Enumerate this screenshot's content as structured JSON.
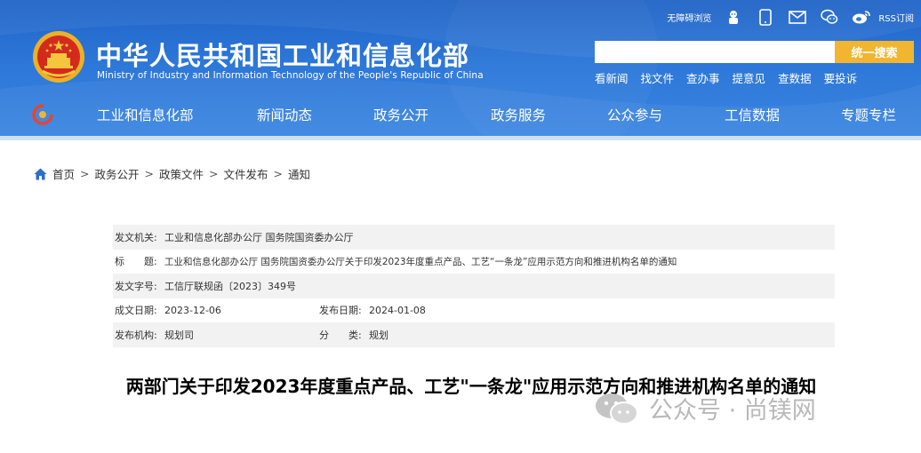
{
  "header": {
    "site_name_cn": "中华人民共和国工业和信息化部",
    "site_name_en": "Ministry of Industry and Information Technology of the People's Republic of China",
    "top_utils": {
      "accessibility": "无障碍浏览",
      "rss": "RSS订阅"
    },
    "search": {
      "placeholder": "",
      "button_label": "统一搜索"
    },
    "quick_links": [
      "看新闻",
      "找文件",
      "查办事",
      "提意见",
      "查数据",
      "要投诉"
    ],
    "nav": [
      "工业和信息化部",
      "新闻动态",
      "政务公开",
      "政务服务",
      "公众参与",
      "工信数据",
      "专题专栏"
    ]
  },
  "breadcrumb": [
    "首页",
    "政务公开",
    "政策文件",
    "文件发布",
    "通知"
  ],
  "meta": {
    "issuer_label": "发文机关:",
    "issuer": "工业和信息化部办公厅 国务院国资委办公厅",
    "title_label": "标　　题:",
    "title": "工业和信息化部办公厅 国务院国资委办公厅关于印发2023年度重点产品、工艺“一条龙”应用示范方向和推进机构名单的通知",
    "doc_no_label": "发文字号:",
    "doc_no": "工信厅联规函〔2023〕349号",
    "written_date_label": "成文日期:",
    "written_date": "2023-12-06",
    "publish_date_label": "发布日期:",
    "publish_date": "2024-01-08",
    "publisher_label": "发布机构:",
    "publisher": "规划司",
    "category_label": "分　　类:",
    "category": "规划"
  },
  "document_title": "两部门关于印发2023年度重点产品、工艺\"一条龙\"应用示范方向和推进机构名单的通知",
  "watermark": {
    "text": "公众号 · 尚镁网"
  },
  "colors": {
    "header_blue": "#2d77d8",
    "search_button": "#f1b52f",
    "row_shade": "#f2f2f2"
  }
}
